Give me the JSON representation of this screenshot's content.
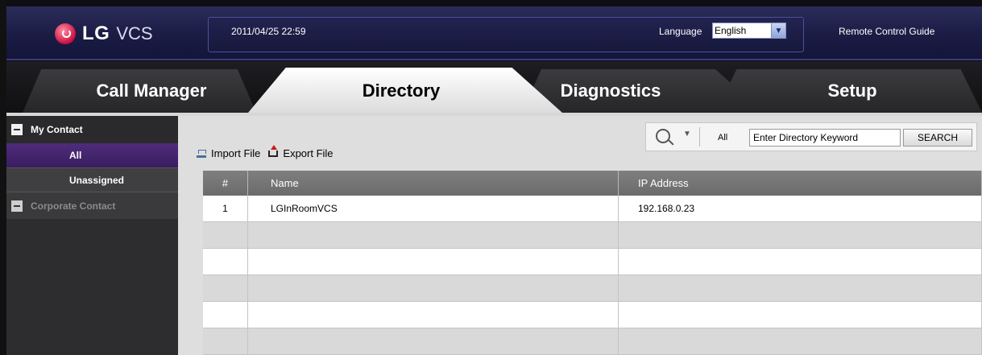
{
  "header": {
    "logo_brand": "LG",
    "logo_product": "VCS",
    "datetime": "2011/04/25 22:59",
    "language_label": "Language",
    "language_value": "English",
    "remote_guide": "Remote Control Guide"
  },
  "tabs": [
    {
      "label": "Call Manager",
      "active": false
    },
    {
      "label": "Directory",
      "active": true
    },
    {
      "label": "Diagnostics",
      "active": false
    },
    {
      "label": "Setup",
      "active": false
    }
  ],
  "sidebar": {
    "my_contact": "My Contact",
    "items": [
      "All",
      "Unassigned"
    ],
    "corporate_contact": "Corporate Contact"
  },
  "toolbar": {
    "scope": "All",
    "keyword": "Enter Directory Keyword",
    "search_button": "SEARCH",
    "import_label": "Import File",
    "export_label": "Export File"
  },
  "table": {
    "headers": [
      "#",
      "Name",
      "IP Address"
    ],
    "rows": [
      {
        "num": "1",
        "name": "LGInRoomVCS",
        "ip": "192.168.0.23"
      },
      {
        "num": "",
        "name": "",
        "ip": ""
      },
      {
        "num": "",
        "name": "",
        "ip": ""
      },
      {
        "num": "",
        "name": "",
        "ip": ""
      },
      {
        "num": "",
        "name": "",
        "ip": ""
      },
      {
        "num": "",
        "name": "",
        "ip": ""
      }
    ]
  },
  "colors": {
    "header_bg": "#1b1c44",
    "active_sidebar": "#4f2c7a",
    "logo_red": "#c70f3f"
  }
}
